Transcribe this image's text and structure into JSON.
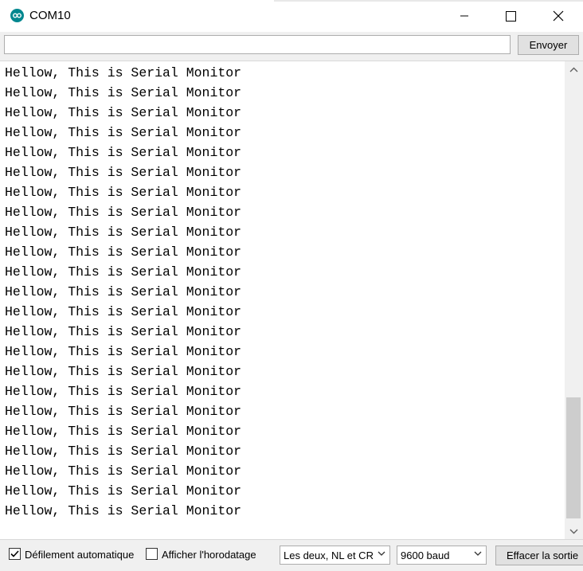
{
  "window": {
    "title": "COM10"
  },
  "input": {
    "value": "",
    "send_label": "Envoyer"
  },
  "output": {
    "lines": [
      "Hellow, This is Serial Monitor",
      "Hellow, This is Serial Monitor",
      "Hellow, This is Serial Monitor",
      "Hellow, This is Serial Monitor",
      "Hellow, This is Serial Monitor",
      "Hellow, This is Serial Monitor",
      "Hellow, This is Serial Monitor",
      "Hellow, This is Serial Monitor",
      "Hellow, This is Serial Monitor",
      "Hellow, This is Serial Monitor",
      "Hellow, This is Serial Monitor",
      "Hellow, This is Serial Monitor",
      "Hellow, This is Serial Monitor",
      "Hellow, This is Serial Monitor",
      "Hellow, This is Serial Monitor",
      "Hellow, This is Serial Monitor",
      "Hellow, This is Serial Monitor",
      "Hellow, This is Serial Monitor",
      "Hellow, This is Serial Monitor",
      "Hellow, This is Serial Monitor",
      "Hellow, This is Serial Monitor",
      "Hellow, This is Serial Monitor",
      "Hellow, This is Serial Monitor"
    ]
  },
  "footer": {
    "autoscroll": {
      "label": "Défilement automatique",
      "checked": true
    },
    "timestamp": {
      "label": "Afficher l'horodatage",
      "checked": false
    },
    "line_ending": "Les deux, NL et CR",
    "baud_rate": "9600 baud",
    "clear_label": "Effacer la sortie"
  },
  "icons": {
    "app": "arduino-logo-icon",
    "minimize": "minimize-icon",
    "maximize": "maximize-icon",
    "close": "close-icon",
    "scroll_up": "chevron-up-icon",
    "scroll_down": "chevron-down-icon",
    "dropdown": "chevron-down-icon",
    "check": "checkmark-icon"
  },
  "colors": {
    "accent": "#00878f"
  }
}
